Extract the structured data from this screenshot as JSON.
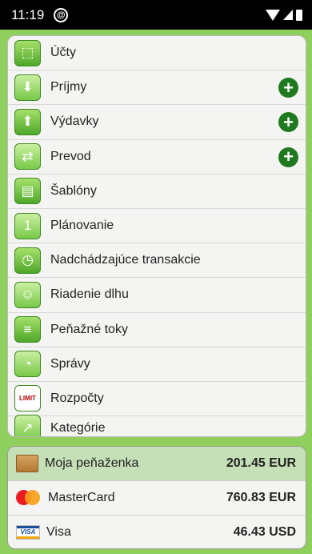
{
  "status_bar": {
    "time": "11:19"
  },
  "menu": {
    "items": [
      {
        "label": "Účty",
        "icon": "accounts-icon",
        "glyph": "⬚",
        "has_add": false
      },
      {
        "label": "Príjmy",
        "icon": "income-icon",
        "glyph": "⬇",
        "has_add": true
      },
      {
        "label": "Výdavky",
        "icon": "expenses-icon",
        "glyph": "⬆",
        "has_add": true
      },
      {
        "label": "Prevod",
        "icon": "transfer-icon",
        "glyph": "⇄",
        "has_add": true
      },
      {
        "label": "Šablóny",
        "icon": "templates-icon",
        "glyph": "▤",
        "has_add": false
      },
      {
        "label": "Plánovanie",
        "icon": "calendar-icon",
        "glyph": "1",
        "has_add": false
      },
      {
        "label": "Nadchádzajúce transakcie",
        "icon": "stopwatch-icon",
        "glyph": "◷",
        "has_add": false
      },
      {
        "label": "Riadenie dlhu",
        "icon": "debt-icon",
        "glyph": "☺",
        "has_add": false
      },
      {
        "label": "Peňažné toky",
        "icon": "cashflow-icon",
        "glyph": "≡",
        "has_add": false
      },
      {
        "label": "Správy",
        "icon": "reports-icon",
        "glyph": "◔",
        "has_add": false
      },
      {
        "label": "Rozpočty",
        "icon": "budget-limit-icon",
        "glyph": "LIMIT",
        "has_add": false
      },
      {
        "label": "Kategórie",
        "icon": "categories-icon",
        "glyph": "↗",
        "has_add": false
      }
    ],
    "add_glyph": "+"
  },
  "accounts": [
    {
      "name": "Moja peňaženka",
      "balance": "201.45 EUR",
      "icon": "wallet-icon",
      "selected": true
    },
    {
      "name": "MasterCard",
      "balance": "760.83 EUR",
      "icon": "mastercard-icon",
      "selected": false
    },
    {
      "name": "Visa",
      "balance": "46.43 USD",
      "icon": "visa-icon",
      "selected": false
    }
  ],
  "visa_mark": "VISA"
}
